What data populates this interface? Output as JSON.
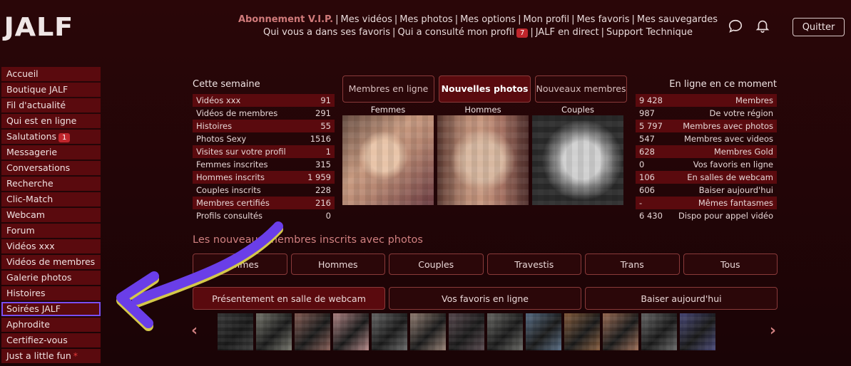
{
  "brand": {
    "logo_text": "JALF"
  },
  "topnav": {
    "row1": [
      {
        "label": "Abonnement V.I.P.",
        "vip": true
      },
      {
        "label": "Mes vidéos"
      },
      {
        "label": "Mes photos"
      },
      {
        "label": "Mes options"
      },
      {
        "label": "Mon profil"
      },
      {
        "label": "Mes favoris"
      },
      {
        "label": "Mes sauvegardes"
      }
    ],
    "row2": [
      {
        "label": "Qui vous a dans ses favoris"
      },
      {
        "label": "Qui a consulté mon profil",
        "badge": "7"
      },
      {
        "label": "JALF en direct"
      },
      {
        "label": "Support Technique"
      }
    ],
    "separator": "|"
  },
  "header": {
    "quit_label": "Quitter",
    "icons": [
      "chat-icon",
      "bell-icon"
    ]
  },
  "sidebar": {
    "items": [
      {
        "label": "Accueil"
      },
      {
        "label": "Boutique JALF"
      },
      {
        "label": "Fil d'actualité"
      },
      {
        "label": "Qui est en ligne"
      },
      {
        "label": "Salutations",
        "badge": "1"
      },
      {
        "label": "Messagerie"
      },
      {
        "label": "Conversations"
      },
      {
        "label": "Recherche"
      },
      {
        "label": "Clic-Match"
      },
      {
        "label": "Webcam"
      },
      {
        "label": "Forum"
      },
      {
        "label": "Vidéos xxx"
      },
      {
        "label": "Vidéos de membres"
      },
      {
        "label": "Galerie photos"
      },
      {
        "label": "Histoires"
      },
      {
        "label": "Soirées JALF",
        "selected": true
      },
      {
        "label": "Aphrodite"
      },
      {
        "label": "Certifiez-vous"
      },
      {
        "label": "Just a little fun",
        "star": "*"
      }
    ]
  },
  "week_stats": {
    "title": "Cette semaine",
    "rows": [
      {
        "label": "Vidéos xxx",
        "value": "91"
      },
      {
        "label": "Vidéos de membres",
        "value": "291"
      },
      {
        "label": "Histoires",
        "value": "55"
      },
      {
        "label": "Photos Sexy",
        "value": "1516"
      },
      {
        "label": "Visites sur votre profil",
        "value": "1"
      },
      {
        "label": "Femmes inscrites",
        "value": "315"
      },
      {
        "label": "Hommes inscrits",
        "value": "1 959"
      },
      {
        "label": "Couples inscrits",
        "value": "228"
      },
      {
        "label": "Membres certifiés",
        "value": "216"
      },
      {
        "label": "Profils consultés",
        "value": "0"
      }
    ]
  },
  "online_stats": {
    "title": "En ligne en ce moment",
    "rows": [
      {
        "value": "9 428",
        "label": "Membres"
      },
      {
        "value": "987",
        "label": "De votre région"
      },
      {
        "value": "5 797",
        "label": "Membres avec photos"
      },
      {
        "value": "547",
        "label": "Membres avec videos"
      },
      {
        "value": "628",
        "label": "Membres Gold"
      },
      {
        "value": "0",
        "label": "Vos favoris en ligne"
      },
      {
        "value": "106",
        "label": "En salles de webcam"
      },
      {
        "value": "606",
        "label": "Baiser aujourd'hui"
      },
      {
        "value": "-",
        "label": "Mêmes fantasmes"
      },
      {
        "value": "6 430",
        "label": "Dispo pour appel vidéo"
      }
    ]
  },
  "center_tabs": [
    {
      "label": "Membres en ligne",
      "active": false
    },
    {
      "label": "Nouvelles photos",
      "active": true
    },
    {
      "label": "Nouveaux membres",
      "active": false
    }
  ],
  "photo_columns": [
    {
      "label": "Femmes"
    },
    {
      "label": "Hommes"
    },
    {
      "label": "Couples"
    }
  ],
  "new_members": {
    "title": "Les nouveaux membres inscrits avec photos",
    "filters": [
      "Femmes",
      "Hommes",
      "Couples",
      "Travestis",
      "Trans",
      "Tous"
    ]
  },
  "webcam_tabs": [
    {
      "label": "Présentement en salle de webcam",
      "active": true
    },
    {
      "label": "Vos favoris en ligne",
      "active": false
    },
    {
      "label": "Baiser aujourd'hui",
      "active": false
    }
  ],
  "carousel": {
    "prev": "‹",
    "next": "›",
    "thumb_colors": [
      "#3a3a3a",
      "#7a7a70",
      "#8a6058",
      "#b88a8a",
      "#6a6a6a",
      "#9a8478",
      "#5a4a50",
      "#6a6a66",
      "#5a7088",
      "#8a6040",
      "#a07058",
      "#6a6a6a",
      "#4a4a7a"
    ]
  },
  "colors": {
    "accent": "#d07a7a",
    "panel": "#5a0a0e",
    "badge": "#c0262c",
    "highlight": "#7a4ef2"
  }
}
